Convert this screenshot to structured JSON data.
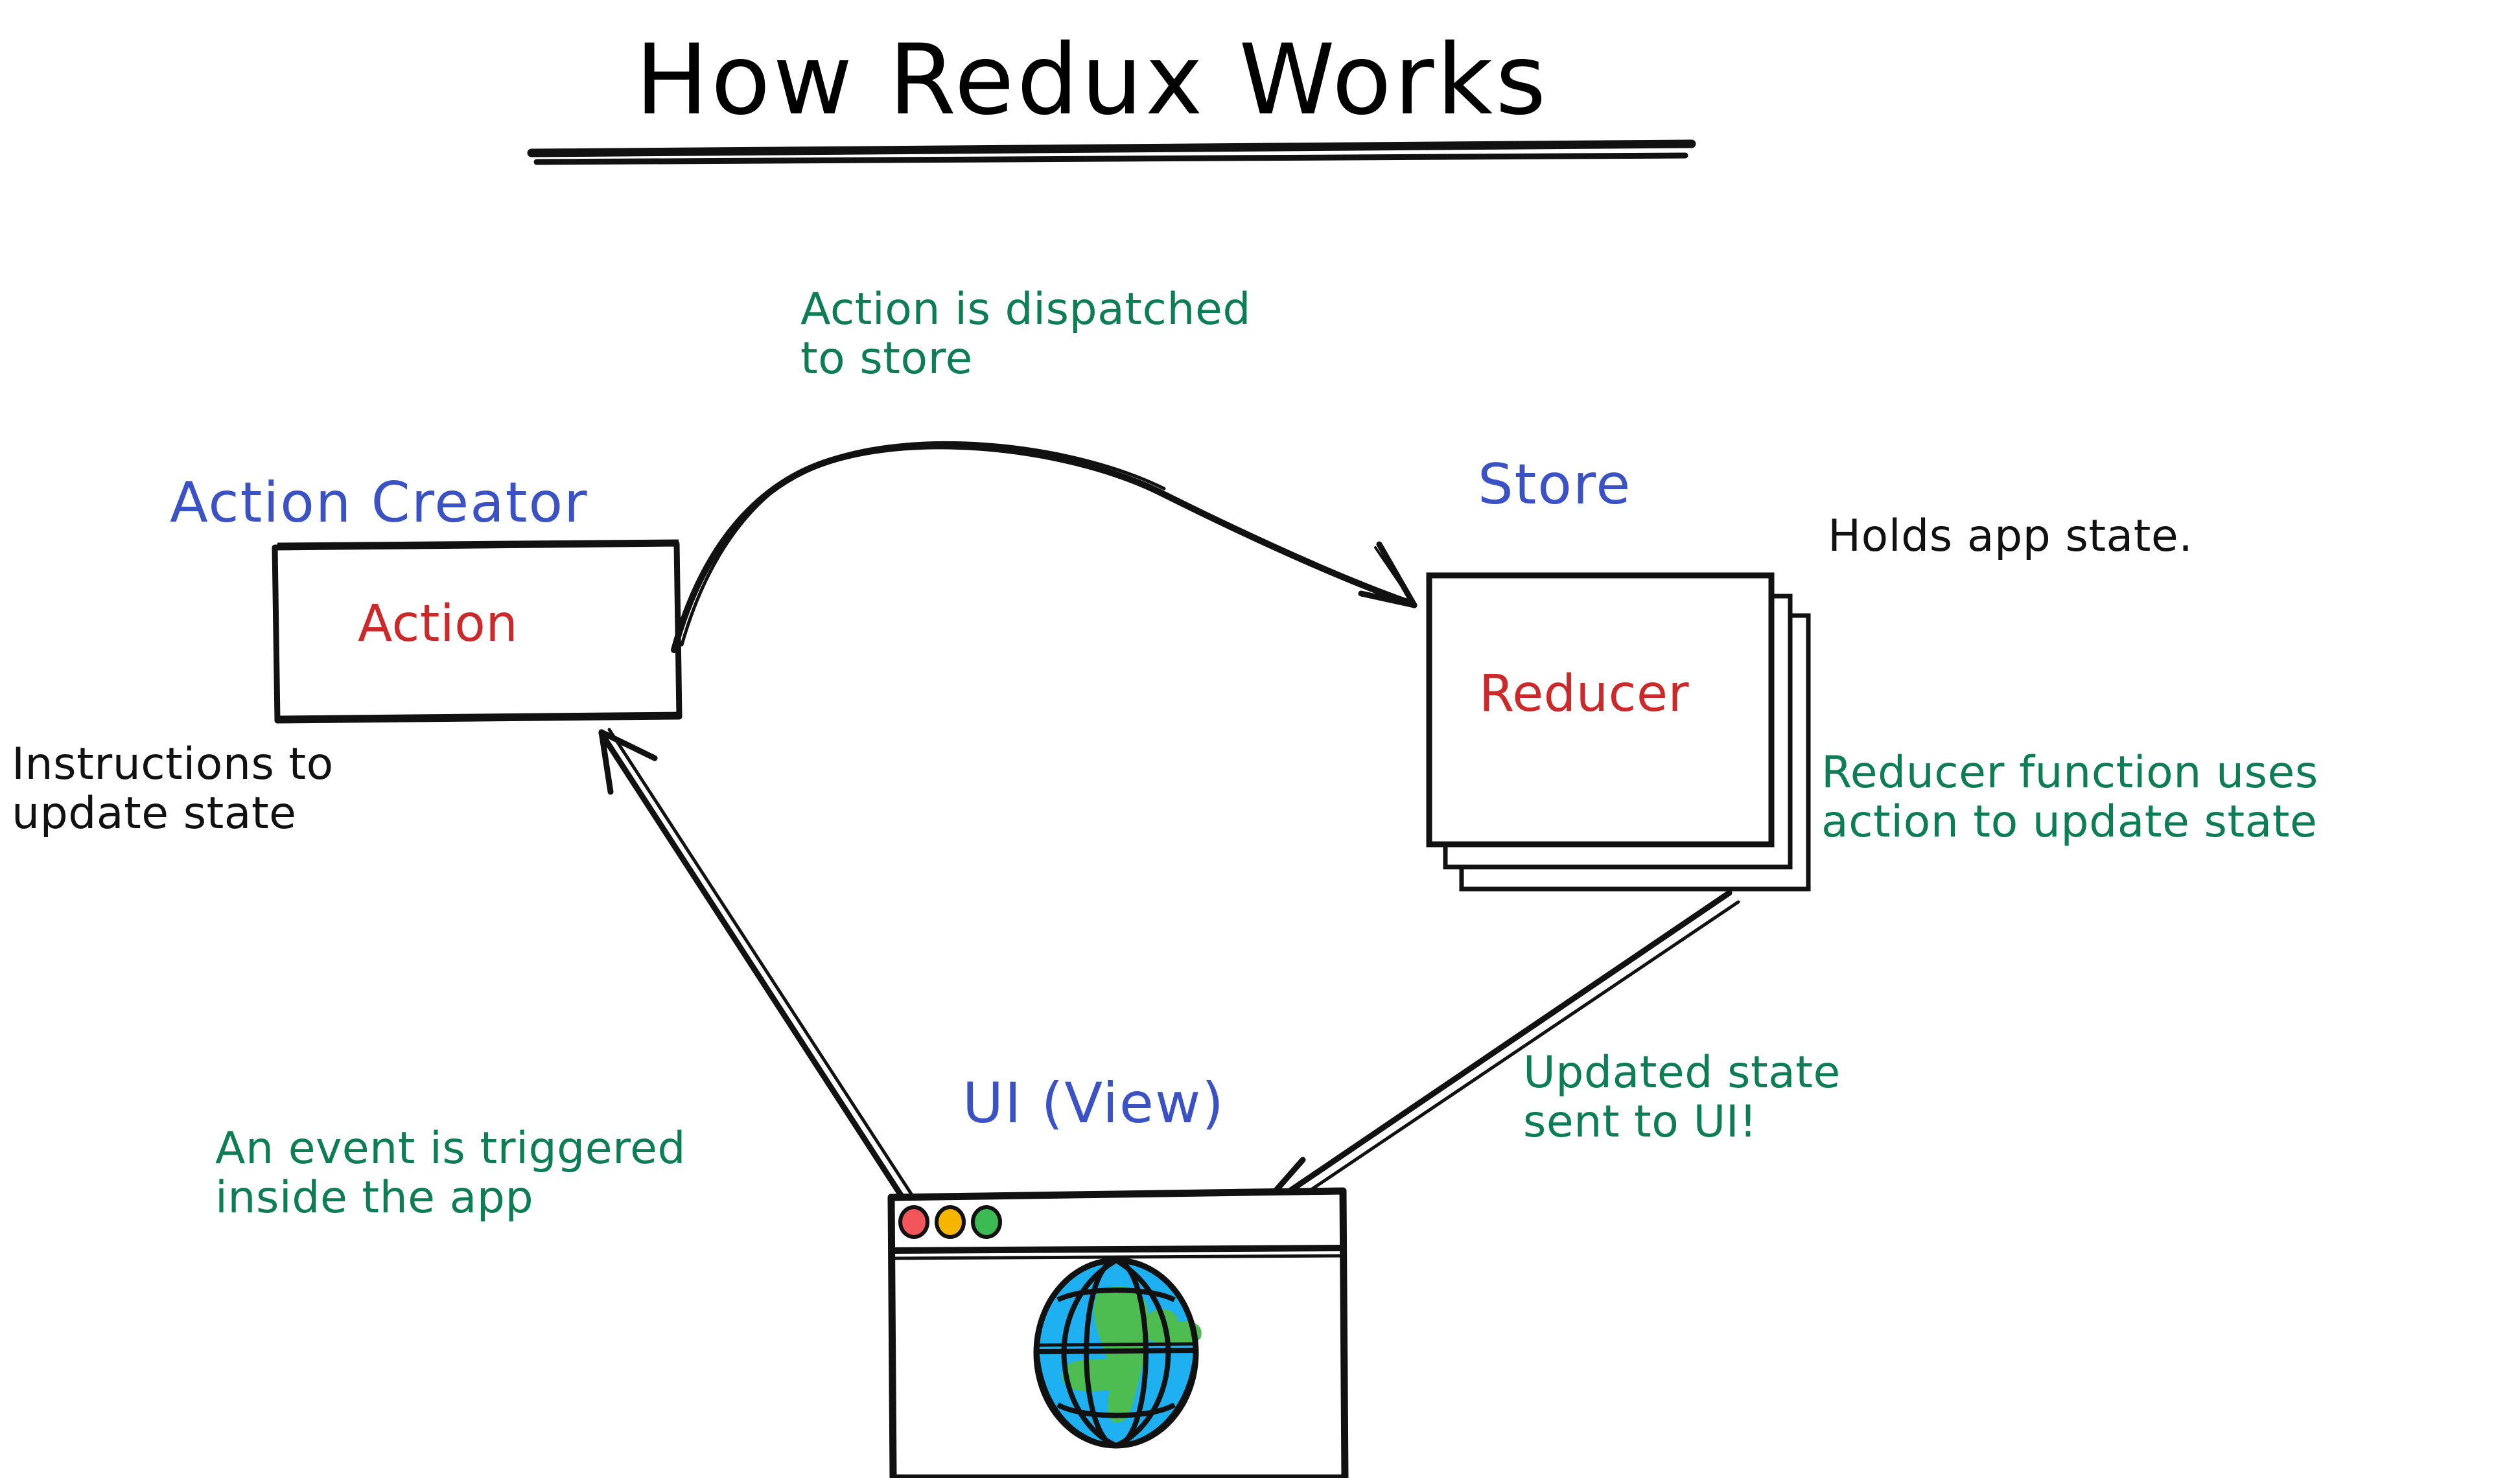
{
  "title": "How Redux Works",
  "nodes": {
    "action_creator": {
      "label": "Action Creator",
      "inner_text": "Action",
      "label_color": "#3b52c4",
      "inner_color": "#cc2a2a"
    },
    "store": {
      "label": "Store",
      "inner_text": "Reducer",
      "label_color": "#3b52c4",
      "inner_color": "#cc2a2a"
    },
    "ui_view": {
      "label": "UI (View)",
      "label_color": "#3b52c4"
    }
  },
  "annotations": {
    "dispatch": "Action is dispatched\nto store",
    "instructions": "Instructions to\nupdate state",
    "holds_state": "Holds app state.",
    "reducer_uses": "Reducer function uses\naction to update state",
    "updated_state": "Updated state\nsent to UI!",
    "event_triggered": "An event is triggered\ninside the app"
  },
  "browser_window": {
    "traffic_lights": [
      {
        "name": "close-dot",
        "color": "#f2555a"
      },
      {
        "name": "minimize-dot",
        "color": "#f7b500"
      },
      {
        "name": "maximize-dot",
        "color": "#3cba54"
      }
    ],
    "content_icon": "globe-icon",
    "globe_ocean_color": "#1eb0f0",
    "globe_land_color": "#4dbd52"
  },
  "arrows": [
    {
      "name": "action-to-store",
      "from": "action_creator",
      "to": "store"
    },
    {
      "name": "store-to-ui",
      "from": "store",
      "to": "ui_view"
    },
    {
      "name": "ui-to-action",
      "from": "ui_view",
      "to": "action_creator"
    }
  ],
  "colors": {
    "ink": "#111111",
    "green": "#0d7d55",
    "blue": "#3b52c4",
    "red": "#cc2a2a"
  }
}
